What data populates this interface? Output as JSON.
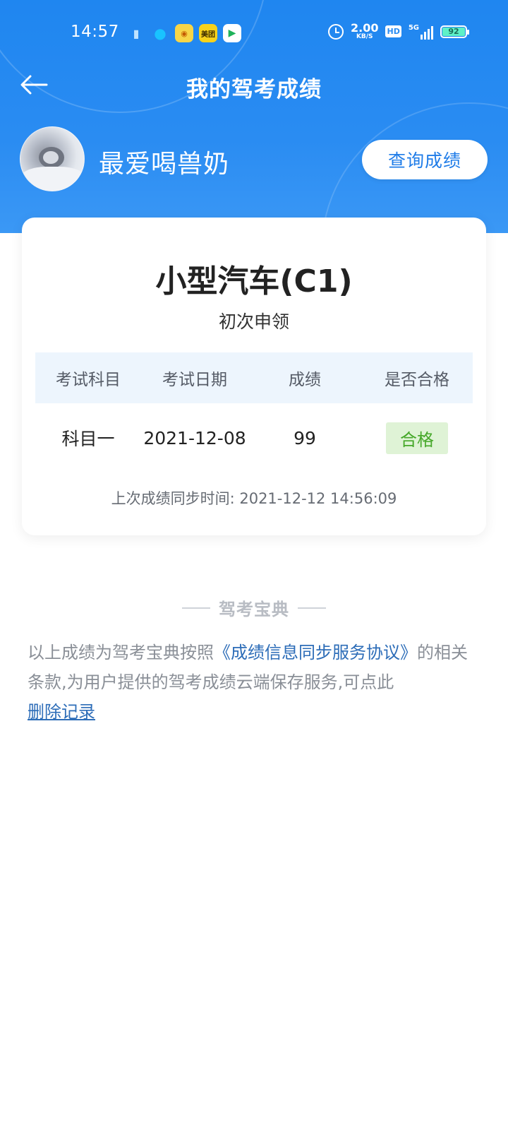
{
  "status_bar": {
    "time": "14:57",
    "notification_icons": [
      "shield-app-icon",
      "qq-icon",
      "tiger-app-icon",
      "meituan-icon",
      "video-app-icon"
    ],
    "meituan_label": "美团",
    "net_speed": "2.00",
    "net_speed_unit": "KB/S",
    "hd_label": "HD",
    "network_label": "5G",
    "battery": "92"
  },
  "header": {
    "title": "我的驾考成绩",
    "back_icon": "back-arrow-icon",
    "colors": {
      "primary": "#2a8cf2",
      "pass_green": "#46a82a",
      "link_blue": "#2d6db8"
    }
  },
  "user": {
    "name": "最爱喝兽奶",
    "query_button": "查询成绩"
  },
  "card": {
    "license_type": "小型汽车(C1)",
    "apply_type": "初次申领",
    "columns": [
      "考试科目",
      "考试日期",
      "成绩",
      "是否合格"
    ],
    "rows": [
      {
        "subject": "科目一",
        "date": "2021-12-08",
        "score": "99",
        "result": "合格"
      }
    ],
    "sync_time": "上次成绩同步时间: 2021-12-12 14:56:09"
  },
  "footer": {
    "brand": "驾考宝典",
    "disclaimer_part1": "以上成绩为驾考宝典按照",
    "agreement_link": "《成绩信息同步服务协议》",
    "disclaimer_part2": "的相关条款,为用户提供的驾考成绩云端保存服务,可点此",
    "delete_link": "删除记录"
  }
}
